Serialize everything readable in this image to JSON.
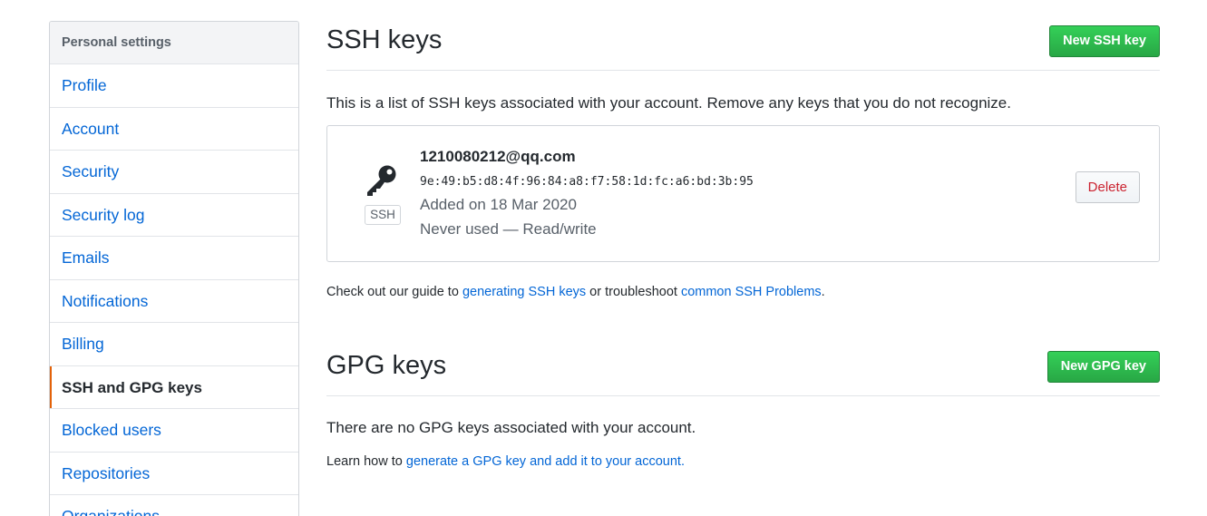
{
  "sidebar": {
    "header": "Personal settings",
    "items": [
      {
        "label": "Profile"
      },
      {
        "label": "Account"
      },
      {
        "label": "Security"
      },
      {
        "label": "Security log"
      },
      {
        "label": "Emails"
      },
      {
        "label": "Notifications"
      },
      {
        "label": "Billing"
      },
      {
        "label": "SSH and GPG keys",
        "selected": true
      },
      {
        "label": "Blocked users"
      },
      {
        "label": "Repositories"
      },
      {
        "label": "Organizations"
      }
    ]
  },
  "ssh": {
    "title": "SSH keys",
    "new_button": "New SSH key",
    "description": "This is a list of SSH keys associated with your account. Remove any keys that you do not recognize.",
    "keys": [
      {
        "title": "1210080212@qq.com",
        "fingerprint": "9e:49:b5:d8:4f:96:84:a8:f7:58:1d:fc:a6:bd:3b:95",
        "added": "Added on 18 Mar 2020",
        "usage": "Never used — Read/write",
        "type_label": "SSH",
        "delete_label": "Delete"
      }
    ],
    "guide": {
      "prefix": "Check out our guide to ",
      "link1": "generating SSH keys",
      "middle": " or troubleshoot ",
      "link2": "common SSH Problems",
      "suffix": "."
    }
  },
  "gpg": {
    "title": "GPG keys",
    "new_button": "New GPG key",
    "empty_text": "There are no GPG keys associated with your account.",
    "learn": {
      "prefix": "Learn how to ",
      "link": "generate a GPG key and add it to your account."
    }
  },
  "colors": {
    "link": "#0366d6",
    "primary_button": "#28a745",
    "selected_marker": "#e36209",
    "danger": "#cb2431"
  }
}
